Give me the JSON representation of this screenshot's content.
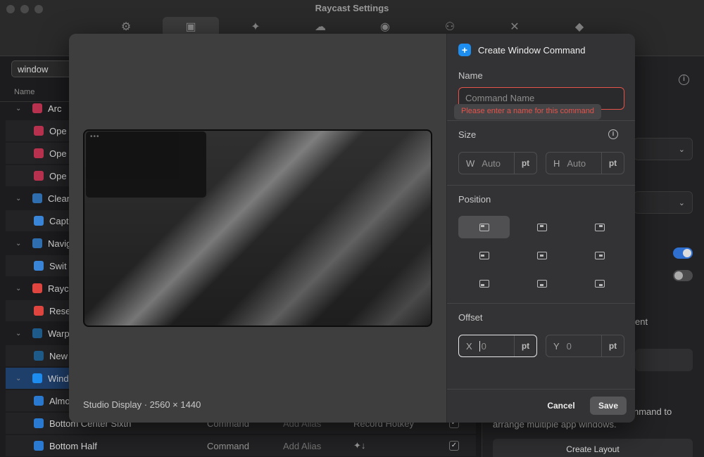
{
  "window": {
    "title": "Raycast Settings",
    "tabs": [
      {
        "icon": "gear-icon",
        "glyph": "⚙"
      },
      {
        "icon": "extensions-chip-icon",
        "glyph": "▣"
      },
      {
        "icon": "ai-sparkle-icon",
        "glyph": "✦"
      },
      {
        "icon": "cloud-sync-icon",
        "glyph": "☁"
      },
      {
        "icon": "account-icon",
        "glyph": "◉"
      },
      {
        "icon": "organizations-icon",
        "glyph": "⚇"
      },
      {
        "icon": "advanced-tools-icon",
        "glyph": "✕"
      },
      {
        "icon": "about-icon",
        "glyph": "◆"
      }
    ]
  },
  "search": {
    "value": "window"
  },
  "table": {
    "column_name": "Name",
    "rows": [
      {
        "name": "Arc",
        "color": "#b8324f",
        "parent": true
      },
      {
        "name": "Ope",
        "color": "#b8324f"
      },
      {
        "name": "Ope",
        "color": "#b8324f"
      },
      {
        "name": "Ope",
        "color": "#b8324f"
      },
      {
        "name": "Clean",
        "color": "#2f6fb0",
        "parent": true
      },
      {
        "name": "Capt",
        "color": "#3a86d8"
      },
      {
        "name": "Navig",
        "color": "#2f6fb0",
        "parent": true
      },
      {
        "name": "Swit",
        "color": "#3a86d8"
      },
      {
        "name": "Rayca",
        "color": "#e0463f",
        "parent": true
      },
      {
        "name": "Rese",
        "color": "#e0463f"
      },
      {
        "name": "Warp",
        "color": "#1f5b8a",
        "parent": true
      },
      {
        "name": "New",
        "color": "#1f5b8a"
      },
      {
        "name": "Windo",
        "color": "#1e8df0",
        "parent": true
      },
      {
        "name": "Almo",
        "color": "#2a7ad1"
      },
      {
        "name": "Bottom Center Sixth",
        "color": "#2a7ad1",
        "type": "Command",
        "alias": "Add Alias",
        "hotkey": "Record Hotkey",
        "enabled": "✓"
      },
      {
        "name": "Bottom Half",
        "color": "#2a7ad1",
        "type": "Command",
        "alias": "Add Alias",
        "hotkey": "✦↓",
        "enabled": "✓"
      }
    ]
  },
  "right_panel": {
    "text_ent": "ent",
    "text_nmand": "nmand to",
    "text_arrange": "arrange multiple app windows.",
    "create_layout_button": "Create Layout"
  },
  "modal": {
    "title": "Create Window Command",
    "name_label": "Name",
    "name_placeholder": "Command Name",
    "name_error": "Please enter a name for this command",
    "size_label": "Size",
    "size_w_letter": "W",
    "size_w_placeholder": "Auto",
    "size_h_letter": "H",
    "size_h_placeholder": "Auto",
    "unit": "pt",
    "position_label": "Position",
    "positions": [
      "top-left",
      "top-center",
      "top-right",
      "center-left",
      "center",
      "center-right",
      "bottom-left",
      "bottom-center",
      "bottom-right"
    ],
    "selected_position": "top-left",
    "offset_label": "Offset",
    "offset_x_letter": "X",
    "offset_x_placeholder": "0",
    "offset_y_letter": "Y",
    "offset_y_placeholder": "0",
    "display_label": "Studio Display · 2560 × 1440",
    "cancel_button": "Cancel",
    "save_button": "Save"
  },
  "colors": {
    "accent_blue": "#1e8df0",
    "error_red": "#e5534b",
    "selected_row": "#1f3f6b",
    "toggle_on": "#2f6fd0"
  }
}
